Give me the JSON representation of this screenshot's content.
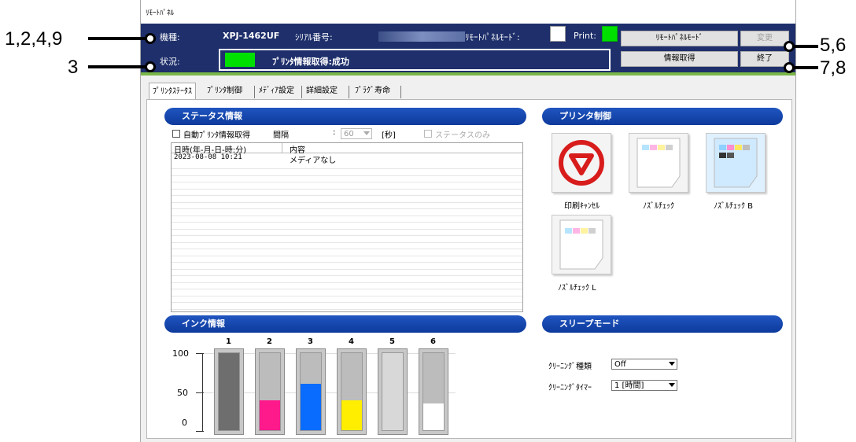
{
  "callouts": {
    "left_top": "1,2,4,9",
    "left_bottom": "3",
    "right_top": "5,6",
    "right_bottom": "7,8"
  },
  "window": {
    "title": "ﾘﾓｰﾄﾊﾟﾈﾙ"
  },
  "header": {
    "model_label": "機種:",
    "model_value": "XPJ-1462UF",
    "serial_label": "ｼﾘｱﾙ番号:",
    "remote_mode_label": "ﾘﾓｰﾄﾊﾟﾈﾙﾓｰﾄﾞ:",
    "print_label": "Print:",
    "status_label": "状況:",
    "status_text": "ﾌﾟﾘﾝﾀ情報取得:成功",
    "btn_remote_mode": "ﾘﾓｰﾄﾊﾟﾈﾙﾓｰﾄﾞ",
    "btn_change": "変更",
    "btn_get_info": "情報取得",
    "btn_exit": "終了"
  },
  "tabs": [
    "ﾌﾟﾘﾝﾀｽﾃｰﾀｽ",
    "ﾌﾟﾘﾝﾀ制御",
    "ﾒﾃﾞｨｱ設定",
    "詳細設定",
    "ﾌﾟﾗｸﾞ寿命"
  ],
  "status_info": {
    "heading": "ステータス情報",
    "auto_get_label": "自動ﾌﾟﾘﾝﾀ情報取得",
    "interval_label": "間隔",
    "interval_sep": ":",
    "interval_value": "60",
    "interval_unit": "[秒]",
    "status_only_label": "ステータスのみ",
    "columns": [
      "日時(年-月-日-時:分)",
      "内容"
    ],
    "rows": [
      [
        "2023-08-08 10:21",
        "メディアなし"
      ]
    ]
  },
  "printer_control": {
    "heading": "プリンタ制御",
    "items": [
      "印刷ｷｬﾝｾﾙ",
      "ﾉｽﾞﾙﾁｪｯｸ",
      "ﾉｽﾞﾙﾁｪｯｸ B",
      "ﾉｽﾞﾙﾁｪｯｸ L"
    ]
  },
  "ink_info": {
    "heading": "インク情報",
    "y_ticks": [
      "100",
      "50",
      "0"
    ],
    "channels": [
      {
        "label": "1",
        "level": 100,
        "color": "#6e6e6e"
      },
      {
        "label": "2",
        "level": 39,
        "color": "#ff1a8c"
      },
      {
        "label": "3",
        "level": 60,
        "color": "#0a6cff"
      },
      {
        "label": "4",
        "level": 39,
        "color": "#ffee00"
      },
      {
        "label": "5",
        "level": 100,
        "color": "#d8d8d8"
      },
      {
        "label": "6",
        "level": 35,
        "color": "#ffffff"
      }
    ]
  },
  "sleep_mode": {
    "heading": "スリープモード",
    "cleaning_type_label": "ｸﾘｰﾆﾝｸﾞ種類",
    "cleaning_type_value": "Off",
    "cleaning_timer_label": "ｸﾘｰﾆﾝｸﾞﾀｲﾏｰ",
    "cleaning_timer_value": "1 [時間]"
  },
  "colors": {
    "header_bg": "#1e2f6b",
    "indicator_green": "#00e000",
    "accent_bar": "#7ab648",
    "section_blue": "#1447b0"
  }
}
